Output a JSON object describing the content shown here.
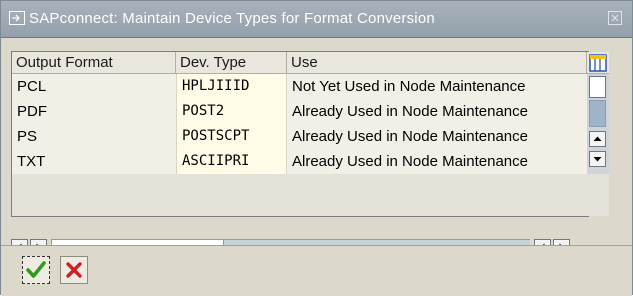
{
  "window": {
    "title": "SAPconnect: Maintain Device Types for Format Conversion"
  },
  "table": {
    "columns": [
      "Output Format",
      "Dev. Type",
      "Use"
    ],
    "rows": [
      {
        "format": "PCL",
        "dev_type": "HPLJIIID",
        "use": "Not Yet Used in Node Maintenance"
      },
      {
        "format": "PDF",
        "dev_type": "POST2",
        "use": "Already Used in Node Maintenance"
      },
      {
        "format": "PS",
        "dev_type": "POSTSCPT",
        "use": "Already Used in Node Maintenance"
      },
      {
        "format": "TXT",
        "dev_type": "ASCIIPRI",
        "use": "Already Used in Node Maintenance"
      }
    ]
  },
  "icons": {
    "title": "dialog-window-icon",
    "column_settings": "column-settings-icon",
    "confirm": "green-check-icon",
    "cancel": "red-x-icon"
  },
  "colors": {
    "titlebar": "#98a4ae",
    "confirm_green": "#2f9a1e",
    "cancel_red": "#d21f1f"
  }
}
